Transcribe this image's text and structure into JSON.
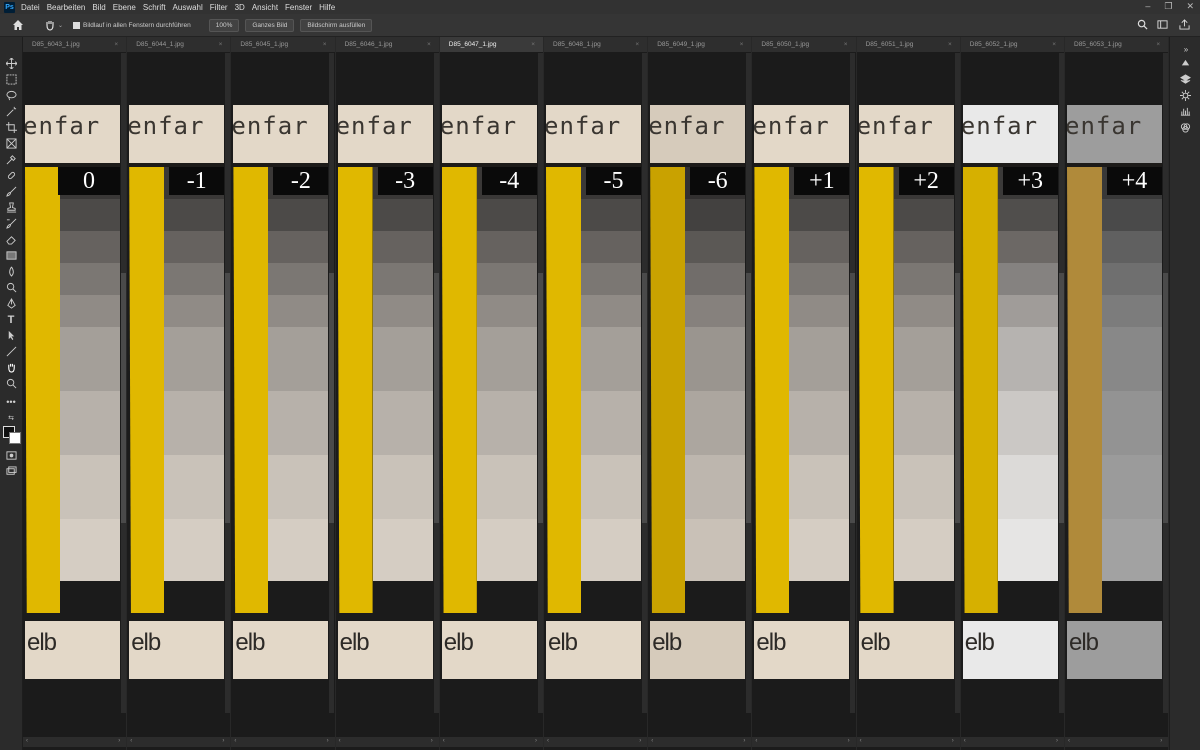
{
  "app": {
    "logo": "Ps"
  },
  "menu": [
    "Datei",
    "Bearbeiten",
    "Bild",
    "Ebene",
    "Schrift",
    "Auswahl",
    "Filter",
    "3D",
    "Ansicht",
    "Fenster",
    "Hilfe"
  ],
  "window_controls": [
    "–",
    "❐",
    "✕"
  ],
  "options": {
    "scroll_all_label": "Bildlauf in allen Fenstern durchführen",
    "zoom_value": "100%",
    "fit_screen_label": "Ganzes Bild",
    "fill_screen_label": "Bildschirm ausfüllen",
    "scroll_all_checked": true
  },
  "documents": [
    {
      "name": "D85_6043_1.jpg",
      "label": "0",
      "active": false,
      "tint": "normal"
    },
    {
      "name": "D85_6044_1.jpg",
      "label": "-1",
      "active": false,
      "tint": "normal"
    },
    {
      "name": "D85_6045_1.jpg",
      "label": "-2",
      "active": false,
      "tint": "normal"
    },
    {
      "name": "D85_6046_1.jpg",
      "label": "-3",
      "active": false,
      "tint": "normal"
    },
    {
      "name": "D85_6047_1.jpg",
      "label": "-4",
      "active": true,
      "tint": "normal"
    },
    {
      "name": "D85_6048_1.jpg",
      "label": "-5",
      "active": false,
      "tint": "normal"
    },
    {
      "name": "D85_6049_1.jpg",
      "label": "-6",
      "active": false,
      "tint": "dim"
    },
    {
      "name": "D85_6050_1.jpg",
      "label": "+1",
      "active": false,
      "tint": "normal"
    },
    {
      "name": "D85_6051_1.jpg",
      "label": "+2",
      "active": false,
      "tint": "normal"
    },
    {
      "name": "D85_6052_1.jpg",
      "label": "+3",
      "active": false,
      "tint": "bright"
    },
    {
      "name": "D85_6053_1.jpg",
      "label": "+4",
      "active": false,
      "tint": "gray"
    }
  ],
  "label_top_text": "enfar",
  "label_bottom_text": "elb",
  "tab_close": "×",
  "scroll_left": "‹",
  "scroll_right": "›",
  "colors": {
    "yellow": "#e0b800",
    "label_paper": "#e2d7c7",
    "number_box": "#0a0a0a"
  },
  "tools": [
    "move-icon",
    "marquee-icon",
    "lasso-icon",
    "magic-wand-icon",
    "crop-icon",
    "frame-icon",
    "eyedropper-icon",
    "healing-brush-icon",
    "brush-icon",
    "stamp-icon",
    "history-brush-icon",
    "eraser-icon",
    "gradient-icon",
    "blur-icon",
    "dodge-icon",
    "pen-icon",
    "type-icon",
    "path-selection-icon",
    "line-icon",
    "hand-icon",
    "zoom-icon",
    "more-tools-icon"
  ],
  "right_panel_icons": [
    "color-panel-icon",
    "layers-panel-icon",
    "adjustments-panel-icon",
    "libraries-panel-icon",
    "channels-panel-icon"
  ]
}
